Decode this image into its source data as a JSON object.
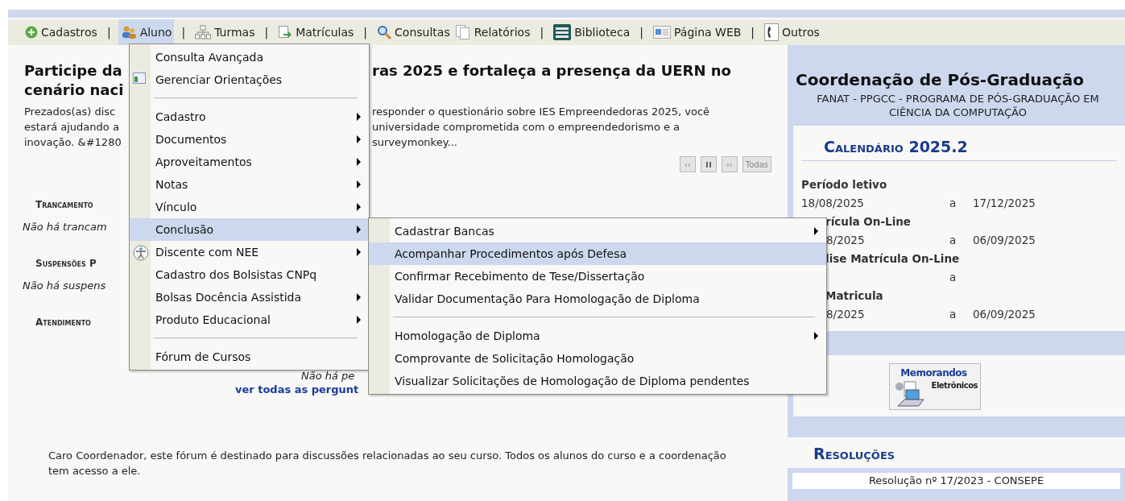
{
  "menubar": [
    {
      "label": "Cadastros",
      "selected": false,
      "separator": "|"
    },
    {
      "label": "Aluno",
      "selected": true,
      "separator": "|"
    },
    {
      "label": "Turmas",
      "selected": false,
      "separator": "|"
    },
    {
      "label": "Matrículas",
      "selected": false,
      "separator": "|"
    },
    {
      "label": "Consultas",
      "selected": false
    },
    {
      "label": "Relatórios",
      "selected": false,
      "separator": "|"
    },
    {
      "label": "Biblioteca",
      "selected": false,
      "separator": "|"
    },
    {
      "label": "Página WEB",
      "selected": false,
      "separator": "|"
    },
    {
      "label": "Outros",
      "selected": false
    }
  ],
  "aluno_menu": [
    {
      "kind": "item",
      "label": "Consulta Avançada",
      "submenu": false,
      "selected": false
    },
    {
      "kind": "item",
      "label": "Gerenciar Orientações",
      "submenu": false,
      "selected": false
    },
    {
      "kind": "separator"
    },
    {
      "kind": "item",
      "label": "Cadastro",
      "submenu": true,
      "selected": false
    },
    {
      "kind": "item",
      "label": "Documentos",
      "submenu": true,
      "selected": false
    },
    {
      "kind": "item",
      "label": "Aproveitamentos",
      "submenu": true,
      "selected": false
    },
    {
      "kind": "item",
      "label": "Notas",
      "submenu": true,
      "selected": false
    },
    {
      "kind": "item",
      "label": "Vínculo",
      "submenu": true,
      "selected": false
    },
    {
      "kind": "item",
      "label": "Conclusão",
      "submenu": true,
      "selected": true
    },
    {
      "kind": "item",
      "label": "Discente com NEE",
      "submenu": true,
      "selected": false
    },
    {
      "kind": "item",
      "label": "Cadastro dos Bolsistas CNPq",
      "submenu": false,
      "selected": false
    },
    {
      "kind": "item",
      "label": "Bolsas Docência Assistida",
      "submenu": true,
      "selected": false
    },
    {
      "kind": "item",
      "label": "Produto Educacional",
      "submenu": true,
      "selected": false
    },
    {
      "kind": "separator"
    },
    {
      "kind": "item",
      "label": "Fórum de Cursos",
      "submenu": false,
      "selected": false
    }
  ],
  "conclusao_menu": [
    {
      "kind": "item",
      "label": "Cadastrar Bancas",
      "submenu": true,
      "selected": false
    },
    {
      "kind": "item",
      "label": "Acompanhar Procedimentos após Defesa",
      "submenu": false,
      "selected": true
    },
    {
      "kind": "item",
      "label": "Confirmar Recebimento de Tese/Dissertação",
      "submenu": false,
      "selected": false
    },
    {
      "kind": "item",
      "label": "Validar Documentação Para Homologação de Diploma",
      "submenu": false,
      "selected": false
    },
    {
      "kind": "separator"
    },
    {
      "kind": "item",
      "label": "Homologação de Diploma",
      "submenu": true,
      "selected": false
    },
    {
      "kind": "item",
      "label": "Comprovante de Solicitação Homologação",
      "submenu": false,
      "selected": false
    },
    {
      "kind": "item",
      "label": "Visualizar Solicitações de Homologação de Diploma pendentes",
      "submenu": false,
      "selected": false
    }
  ],
  "news": {
    "headline": [
      {
        "left": "Participe da",
        "right": "ras 2025 e fortaleça a presença da UERN no"
      },
      {
        "left": "cenário naci"
      }
    ],
    "body": [
      {
        "left": "Prezados(as) disc",
        "right": "responder o questionário sobre IES Empreendedoras 2025, você"
      },
      {
        "left": "estará ajudando a",
        "right": "universidade comprometida com o empreendedorismo e a"
      },
      {
        "left": "inovação. &#1280",
        "right": "surveymonkey..."
      }
    ],
    "controls": [
      {
        "label": "‹‹",
        "kind": "text"
      },
      {
        "kind": "pause"
      },
      {
        "label": "››",
        "kind": "text"
      },
      {
        "label": "Todas",
        "kind": "text"
      }
    ]
  },
  "sections": [
    {
      "title": "Trancamento",
      "empty": "Não há trancam"
    },
    {
      "title": "Suspensões P",
      "empty": "Não há suspens"
    },
    {
      "title": "Atendimento"
    }
  ],
  "atendimento": {
    "empty": "Não há pe",
    "link": "ver todas as pergunt"
  },
  "forum_note": "Caro Coordenador, este fórum é destinado para discussões relacionadas ao seu curso. Todos os alunos do curso e a coordenação tem acesso a ele.",
  "sidebar": {
    "title": "Coordenação de Pós-Graduação",
    "subtitle": "FANAT - PPGCC - PROGRAMA DE PÓS-GRADUAÇÃO EM CIÊNCIA DA COMPUTAÇÃO",
    "calendar_title": "Calendário 2025.2",
    "calendar": [
      {
        "label": "Período letivo",
        "start": "18/08/2025",
        "sep": "a",
        "end": "17/12/2025"
      },
      {
        "label": "rícula On-Line",
        "start": "8/2025",
        "sep": "a",
        "end": "06/09/2025"
      },
      {
        "label": "lise Matrícula On-Line",
        "sep": "a"
      },
      {
        "label": "Matricula",
        "start": "8/2025",
        "sep": "a",
        "end": "06/09/2025"
      }
    ],
    "memorandos": [
      "Memorandos",
      "Eletrônicos"
    ],
    "resolucoes_title": "Resoluções",
    "resolucoes": [
      "Resolução nº 17/2023 - CONSEPE"
    ]
  }
}
